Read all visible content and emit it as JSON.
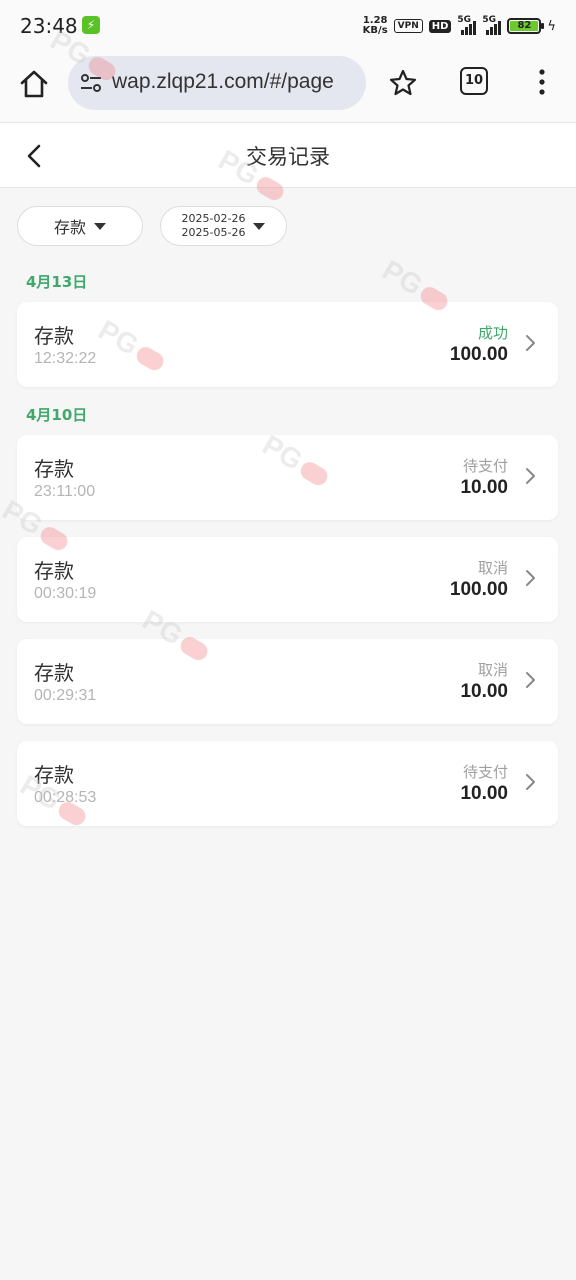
{
  "status_bar": {
    "time": "23:48",
    "app_badge": "⚡",
    "net_speed_value": "1.28",
    "net_speed_unit": "KB/s",
    "vpn": "VPN",
    "hd": "HD",
    "signal1_label": "5G",
    "signal2_label": "5G",
    "battery": "82"
  },
  "browser": {
    "url": "wap.zlqp21.com/#/page",
    "tab_count": "10"
  },
  "header": {
    "title": "交易记录"
  },
  "filters": {
    "type_label": "存款",
    "date_start": "2025-02-26",
    "date_end": "2025-05-26"
  },
  "groups": [
    {
      "date": "4月13日",
      "items": [
        {
          "type": "存款",
          "time": "12:32:22",
          "status": "成功",
          "amount": "100.00"
        }
      ]
    },
    {
      "date": "4月10日",
      "items": [
        {
          "type": "存款",
          "time": "23:11:00",
          "status": "待支付",
          "amount": "10.00"
        },
        {
          "type": "存款",
          "time": "00:30:19",
          "status": "取消",
          "amount": "100.00"
        },
        {
          "type": "存款",
          "time": "00:29:31",
          "status": "取消",
          "amount": "10.00"
        },
        {
          "type": "存款",
          "time": "00:28:53",
          "status": "待支付",
          "amount": "10.00"
        }
      ]
    }
  ],
  "watermark": "PG",
  "colors": {
    "success": "#3fa86a",
    "accent_green": "#3fa86a"
  }
}
